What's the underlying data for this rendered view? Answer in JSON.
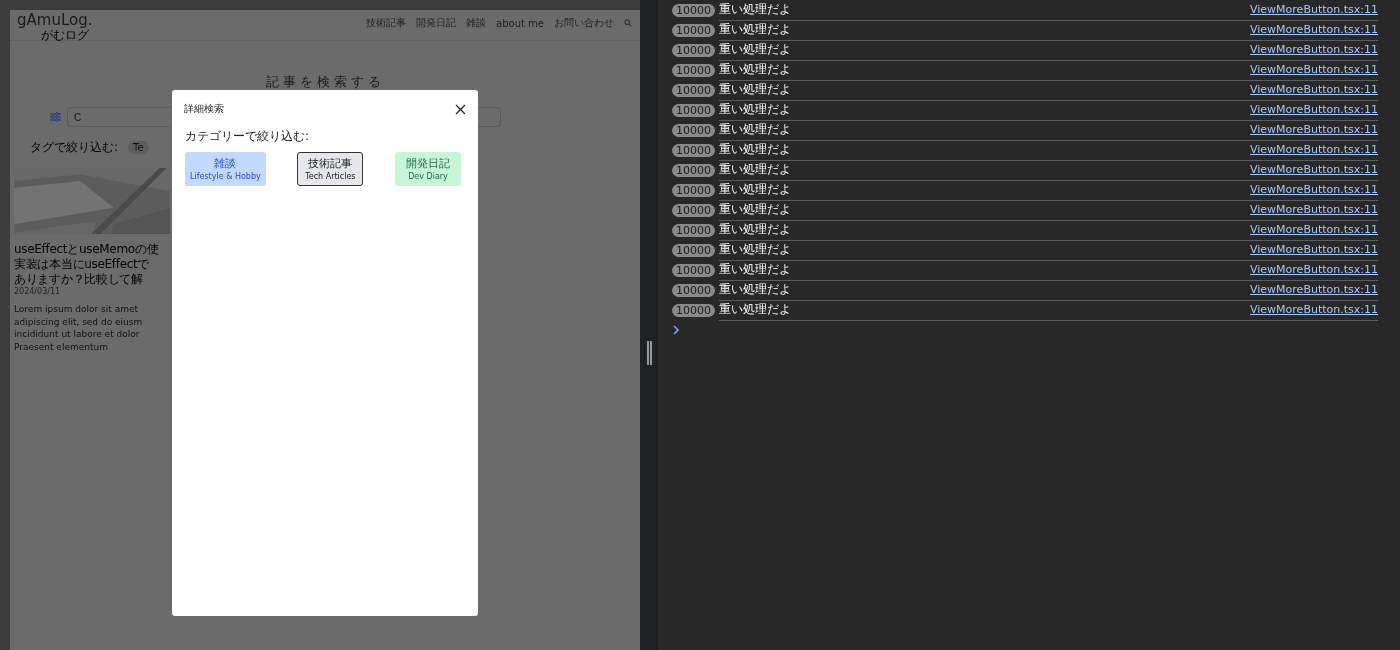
{
  "site": {
    "logo": "gAmuLog.",
    "logo_sub": "がむログ",
    "nav": [
      "技術記事",
      "開発日記",
      "雑談",
      "about me",
      "お問い合わせ"
    ],
    "heading": "記事を検索する",
    "search": {
      "placeholder": "C"
    },
    "tag_filter": {
      "label": "タグで絞り込む:",
      "tags": [
        "Te"
      ]
    },
    "article": {
      "kind": "picture",
      "title_lines": [
        "useEffectとuseMemoの使",
        "実装は本当にuseEffectで",
        "ありますか？比較して解"
      ],
      "date": "2024/03/11",
      "excerpt_lines": [
        "Lorem ipsum dolor sit amet",
        "adipiscing elit, sed do eiusm",
        "incididunt ut labore et dolor",
        "Praesent elementum"
      ]
    }
  },
  "modal": {
    "title": "詳細検索",
    "category_label": "カテゴリーで絞り込む:",
    "categories": [
      {
        "label": "雑談",
        "sub": "Lifestyle & Hobby",
        "color": "#c3dafe",
        "selected": false
      },
      {
        "label": "技術記事",
        "sub": "Tech Articles",
        "color": "#e5e7eb",
        "selected": true
      },
      {
        "label": "開発日記",
        "sub": "Dev Diary",
        "color": "#c6f6d5",
        "selected": false
      }
    ]
  },
  "console": {
    "rows": [
      {
        "count": "10000",
        "message": "重い処理だよ",
        "source": "ViewMoreButton.tsx:11"
      },
      {
        "count": "10000",
        "message": "重い処理だよ",
        "source": "ViewMoreButton.tsx:11"
      },
      {
        "count": "10000",
        "message": "重い処理だよ",
        "source": "ViewMoreButton.tsx:11"
      },
      {
        "count": "10000",
        "message": "重い処理だよ",
        "source": "ViewMoreButton.tsx:11"
      },
      {
        "count": "10000",
        "message": "重い処理だよ",
        "source": "ViewMoreButton.tsx:11"
      },
      {
        "count": "10000",
        "message": "重い処理だよ",
        "source": "ViewMoreButton.tsx:11"
      },
      {
        "count": "10000",
        "message": "重い処理だよ",
        "source": "ViewMoreButton.tsx:11"
      },
      {
        "count": "10000",
        "message": "重い処理だよ",
        "source": "ViewMoreButton.tsx:11"
      },
      {
        "count": "10000",
        "message": "重い処理だよ",
        "source": "ViewMoreButton.tsx:11"
      },
      {
        "count": "10000",
        "message": "重い処理だよ",
        "source": "ViewMoreButton.tsx:11"
      },
      {
        "count": "10000",
        "message": "重い処理だよ",
        "source": "ViewMoreButton.tsx:11"
      },
      {
        "count": "10000",
        "message": "重い処理だよ",
        "source": "ViewMoreButton.tsx:11"
      },
      {
        "count": "10000",
        "message": "重い処理だよ",
        "source": "ViewMoreButton.tsx:11"
      },
      {
        "count": "10000",
        "message": "重い処理だよ",
        "source": "ViewMoreButton.tsx:11"
      },
      {
        "count": "10000",
        "message": "重い処理だよ",
        "source": "ViewMoreButton.tsx:11"
      },
      {
        "count": "10000",
        "message": "重い処理だよ",
        "source": "ViewMoreButton.tsx:11"
      }
    ]
  }
}
